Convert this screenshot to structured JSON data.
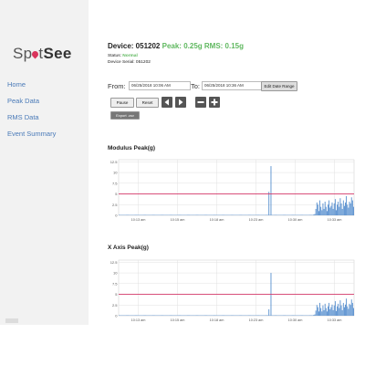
{
  "sidebar": {
    "logo_part1": "Sp",
    "logo_part2": "t",
    "logo_part3": "See",
    "items": [
      {
        "label": "Home"
      },
      {
        "label": "Peak Data"
      },
      {
        "label": "RMS Data"
      },
      {
        "label": "Event Summary"
      }
    ]
  },
  "header": {
    "device_label": "Device: 051202",
    "peak_text": "Peak: 0.25g",
    "rms_text": "RMS: 0.15g",
    "status_label": "Status:",
    "status_value": "Normal",
    "serial": "Device Serial: 051202"
  },
  "range": {
    "from_label": "From:",
    "from_value": "06/25/2018 10:06 AM",
    "to_label": "To:",
    "to_value": "06/25/2018 10:36 AM",
    "edit_button": "Edit Date Range"
  },
  "controls": {
    "pause": "Pause",
    "reset": "Reset",
    "export": "Export .csv",
    "icons": [
      "prev-icon",
      "next-icon",
      "zoom-out-icon",
      "zoom-in-icon"
    ]
  },
  "colors": {
    "bar": "#3f7fc8",
    "threshold": "#d4386a",
    "grid": "#e0e0e0"
  },
  "chart_data": [
    {
      "type": "bar",
      "title": "Modulus Peak(g)",
      "ylim": [
        0,
        13
      ],
      "yticks": [
        "0",
        "2.5",
        "5",
        "7.5",
        "10",
        "12.5"
      ],
      "xticks": [
        "10:13 am",
        "10:15 am",
        "10:18 am",
        "10:23 am",
        "10:30 am",
        "10:33 am"
      ],
      "threshold": 5,
      "values": [
        0.1,
        0.1,
        0.1,
        0.1,
        0.1,
        0.1,
        0.1,
        0.1,
        0.1,
        0.1,
        0.1,
        0.1,
        0.1,
        0.1,
        0.1,
        0.1,
        0.1,
        0.1,
        0.1,
        0.1,
        0.1,
        0.1,
        0.1,
        0.1,
        0.1,
        0.1,
        0.1,
        0.1,
        0.1,
        0.1,
        0.1,
        0.1,
        0.1,
        0.1,
        0.1,
        0.1,
        0.1,
        0.1,
        0.1,
        0.1,
        0.1,
        0.1,
        0.1,
        0.1,
        0.1,
        0.1,
        0.1,
        0.1,
        0.1,
        0.1,
        0.1,
        0.1,
        0.1,
        0.1,
        0.1,
        0.1,
        0.1,
        0.1,
        0.1,
        0.1,
        0.1,
        0.1,
        0.1,
        0.1,
        0.1,
        0.1,
        0.1,
        0.1,
        0.1,
        0.1,
        0.1,
        0.1,
        0.1,
        0.1,
        0.1,
        0.1,
        0.1,
        0.1,
        0.1,
        0.1,
        0.1,
        0.1,
        0.1,
        0.1,
        0.1,
        0.1,
        0.1,
        0.1,
        0.1,
        0.1,
        0.1,
        0.1,
        0.1,
        0.1,
        0.1,
        0.1,
        0.1,
        0.1,
        0.1,
        0.1,
        0.1,
        0.1,
        0.1,
        0.1,
        0.1,
        0.1,
        0.1,
        0.1,
        0.1,
        0.1,
        0.1,
        0.1,
        0.1,
        0.1,
        0.1,
        0.1,
        0.1,
        0.1,
        0.1,
        0.1,
        0.1,
        0.1,
        0.1,
        0.1,
        0.1,
        0.1,
        0.1,
        0.1,
        0.1,
        0.1,
        0.1,
        0.1,
        0.1,
        0.1,
        0.1,
        0.1,
        0.1,
        0.1,
        0.1,
        0.1,
        0.1,
        0.1,
        0.1,
        0.1,
        0.1,
        0.1,
        0.1,
        5.5,
        0.1,
        11.5,
        0.1,
        0.1,
        0.1,
        0.1,
        0.1,
        0.1,
        0.1,
        0.1,
        0.1,
        0.1,
        0.1,
        0.1,
        0.1,
        0.1,
        0.1,
        0.1,
        0.1,
        0.1,
        0.1,
        0.1,
        0.1,
        0.1,
        0.1,
        0.1,
        0.1,
        0.1,
        0.1,
        0.1,
        0.1,
        0.1,
        0.1,
        0.1,
        0.1,
        0.1,
        0.1,
        0.1,
        0.1,
        0.1,
        0.1,
        0.1,
        0.1,
        0.2,
        0.3,
        1.5,
        3,
        2.5,
        1,
        3.5,
        2,
        1.2,
        2.8,
        1.5,
        3.2,
        2,
        1,
        2.5,
        3.5,
        1.8,
        2.2,
        3,
        1.5,
        2.8,
        3.8,
        1.2,
        2.5,
        3.2,
        2,
        4,
        2.8,
        1.5,
        3.5,
        2.2,
        3,
        4.5,
        2.5,
        1.8,
        3.2,
        2.8,
        4.2,
        3.5,
        2
      ],
      "xlabel": "",
      "ylabel": ""
    },
    {
      "type": "bar",
      "title": "X Axis Peak(g)",
      "ylim": [
        0,
        13
      ],
      "yticks": [
        "0",
        "2.5",
        "5",
        "7.5",
        "10",
        "12.5"
      ],
      "xticks": [
        "10:13 am",
        "10:15 am",
        "10:18 am",
        "10:23 am",
        "10:30 am",
        "10:33 am"
      ],
      "threshold": 5,
      "values": [
        0.1,
        0.1,
        0.1,
        0.1,
        0.1,
        0.1,
        0.1,
        0.1,
        0.1,
        0.1,
        0.1,
        0.1,
        0.1,
        0.1,
        0.1,
        0.1,
        0.1,
        0.1,
        0.1,
        0.1,
        0.1,
        0.1,
        0.1,
        0.1,
        0.1,
        0.1,
        0.1,
        0.1,
        0.1,
        0.1,
        0.1,
        0.1,
        0.1,
        0.1,
        0.1,
        0.1,
        0.1,
        0.1,
        0.1,
        0.1,
        0.1,
        0.1,
        0.1,
        0.1,
        0.1,
        0.1,
        0.1,
        0.1,
        0.1,
        0.1,
        0.1,
        0.1,
        0.1,
        0.1,
        0.1,
        0.1,
        0.1,
        0.1,
        0.1,
        0.1,
        0.1,
        0.1,
        0.1,
        0.1,
        0.1,
        0.1,
        0.1,
        0.1,
        0.1,
        0.1,
        0.1,
        0.1,
        0.1,
        0.1,
        0.1,
        0.1,
        0.1,
        0.1,
        0.1,
        0.1,
        0.1,
        0.1,
        0.1,
        0.1,
        0.1,
        0.1,
        0.1,
        0.1,
        0.1,
        0.1,
        0.1,
        0.1,
        0.1,
        0.1,
        0.1,
        0.1,
        0.1,
        0.1,
        0.1,
        0.1,
        0.1,
        0.1,
        0.1,
        0.1,
        0.1,
        0.1,
        0.1,
        0.1,
        0.1,
        0.1,
        0.1,
        0.1,
        0.1,
        0.1,
        0.1,
        0.1,
        0.1,
        0.1,
        0.1,
        0.1,
        0.1,
        0.1,
        0.1,
        0.1,
        0.1,
        0.1,
        0.1,
        0.1,
        0.1,
        0.1,
        0.1,
        0.1,
        0.1,
        0.1,
        0.1,
        0.1,
        0.1,
        0.1,
        0.1,
        0.1,
        0.1,
        0.1,
        0.1,
        0.1,
        0.1,
        0.1,
        0.1,
        1.5,
        0.1,
        10,
        0.1,
        0.1,
        0.1,
        0.1,
        0.1,
        0.1,
        0.1,
        0.1,
        0.1,
        0.1,
        0.1,
        0.1,
        0.1,
        0.1,
        0.1,
        0.1,
        0.1,
        0.1,
        0.1,
        0.1,
        0.1,
        0.1,
        0.1,
        0.1,
        0.1,
        0.1,
        0.1,
        0.1,
        0.1,
        0.1,
        0.1,
        0.1,
        0.1,
        0.1,
        0.1,
        0.1,
        0.1,
        0.1,
        0.1,
        0.1,
        0.1,
        0.2,
        0.3,
        1.2,
        2.5,
        2,
        1,
        3,
        1.8,
        1,
        2.4,
        1.3,
        2.8,
        1.8,
        1,
        2.2,
        3,
        1.5,
        2,
        2.6,
        1.3,
        2.4,
        3.4,
        1.1,
        2.2,
        2.8,
        1.8,
        3.6,
        2.4,
        1.3,
        3,
        2,
        2.6,
        4,
        2.2,
        1.6,
        2.8,
        2.5,
        3.8,
        3,
        1.8
      ],
      "xlabel": "",
      "ylabel": ""
    }
  ]
}
